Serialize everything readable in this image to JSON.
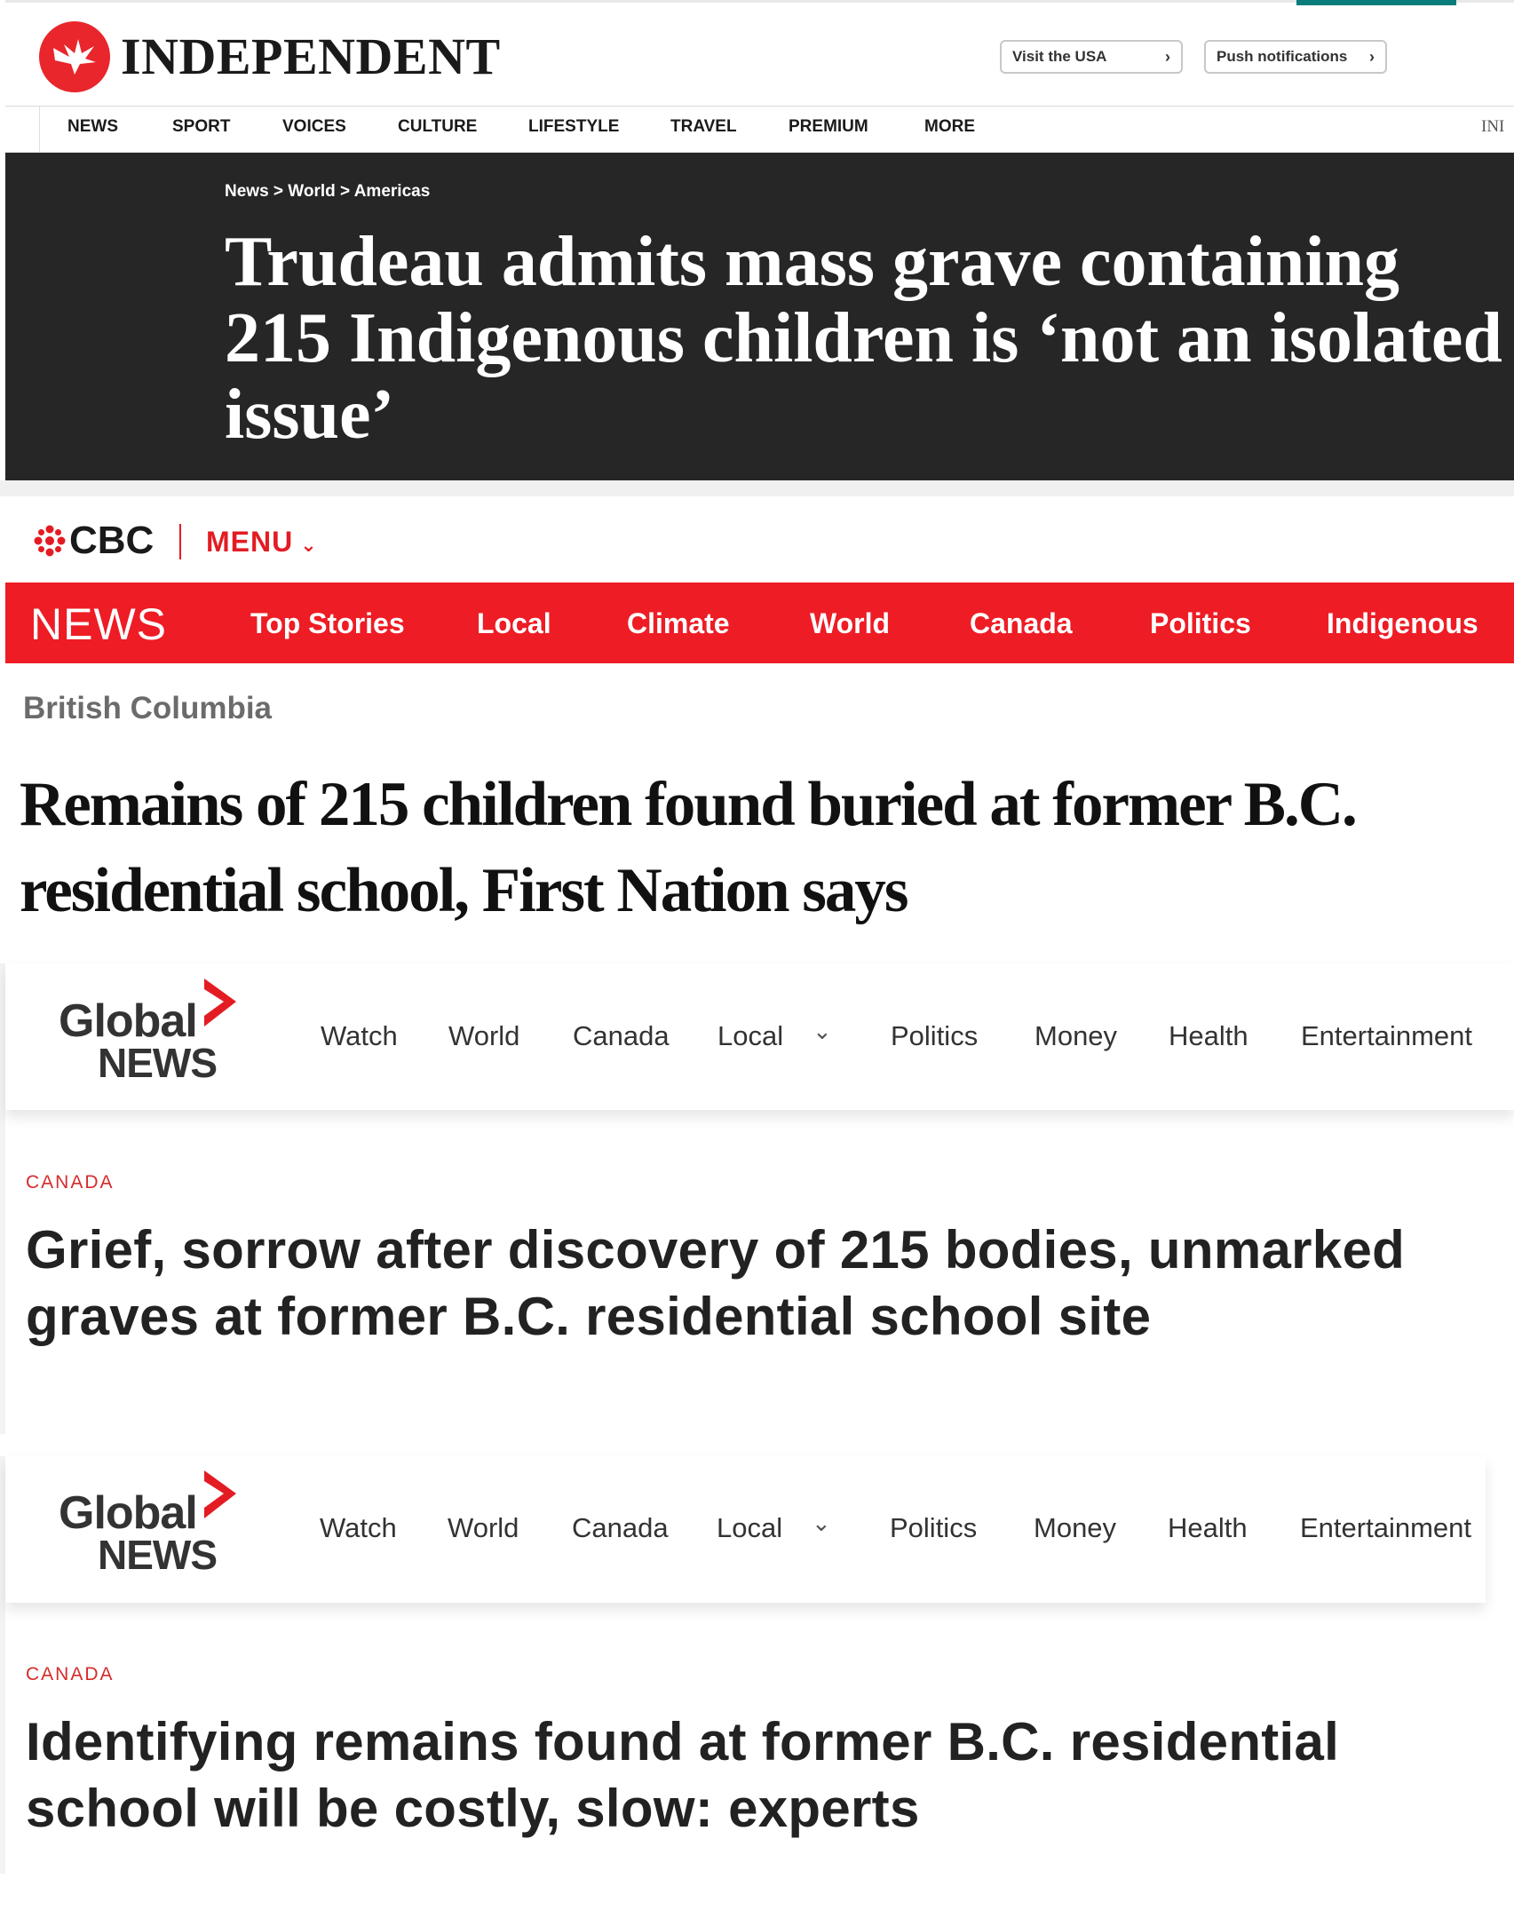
{
  "independent": {
    "logo_text": "INDEPENDENT",
    "visit_usa": "Visit the USA",
    "push_notifications": "Push notifications",
    "nav": [
      "NEWS",
      "SPORT",
      "VOICES",
      "CULTURE",
      "LIFESTYLE",
      "TRAVEL",
      "PREMIUM",
      "MORE",
      "INI"
    ],
    "breadcrumb": "News > World > Americas",
    "headline": "Trudeau admits mass grave containing 215 Indigenous children is ‘not an isolated issue’",
    "colors": {
      "brand_red": "#e8262b",
      "hero_bg": "#262626",
      "accent_teal": "#0a7c7c"
    }
  },
  "cbc": {
    "logo_text": "CBC",
    "menu_label": "MENU",
    "news_label": "NEWS",
    "nav": [
      "Top Stories",
      "Local",
      "Climate",
      "World",
      "Canada",
      "Politics",
      "Indigenous"
    ],
    "region": "British Columbia",
    "headline": "Remains of 215 children found buried at former B.C. residential school, First Nation says",
    "colors": {
      "brand_red": "#ee1c25"
    }
  },
  "global1": {
    "logo_line1": "Global",
    "logo_line2": "NEWS",
    "nav": [
      "Watch",
      "World",
      "Canada",
      "Local",
      "Politics",
      "Money",
      "Health",
      "Entertainment"
    ],
    "category": "CANADA",
    "headline": "Grief, sorrow after discovery of 215 bodies, unmarked graves at former B.C. residential school site"
  },
  "global2": {
    "logo_line1": "Global",
    "logo_line2": "NEWS",
    "nav": [
      "Watch",
      "World",
      "Canada",
      "Local",
      "Politics",
      "Money",
      "Health",
      "Entertainment"
    ],
    "category": "CANADA",
    "headline": "Identifying remains found at former B.C. residential school will be costly, slow: experts"
  },
  "icons": [
    "eagle-icon",
    "chevron-right-icon",
    "cbc-gem-icon",
    "chevron-down-icon",
    "global-chevron-icon"
  ]
}
